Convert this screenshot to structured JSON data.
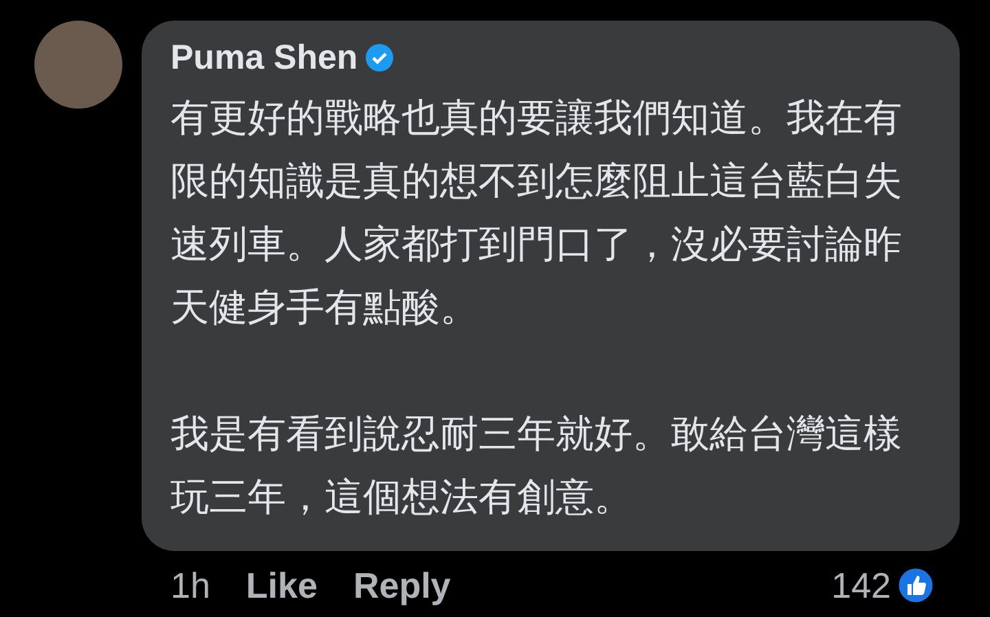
{
  "comment": {
    "author": "Puma Shen",
    "verified": true,
    "paragraphs": [
      "有更好的戰略也真的要讓我們知道。我在有限的知識是真的想不到怎麼阻止這台藍白失速列車。人家都打到門口了，沒必要討論昨天健身手有點酸。",
      "我是有看到說忍耐三年就好。敢給台灣這樣玩三年，這個想法有創意。"
    ]
  },
  "footer": {
    "time": "1h",
    "actions": [
      "Like",
      "Reply"
    ],
    "reaction_count": "142"
  }
}
